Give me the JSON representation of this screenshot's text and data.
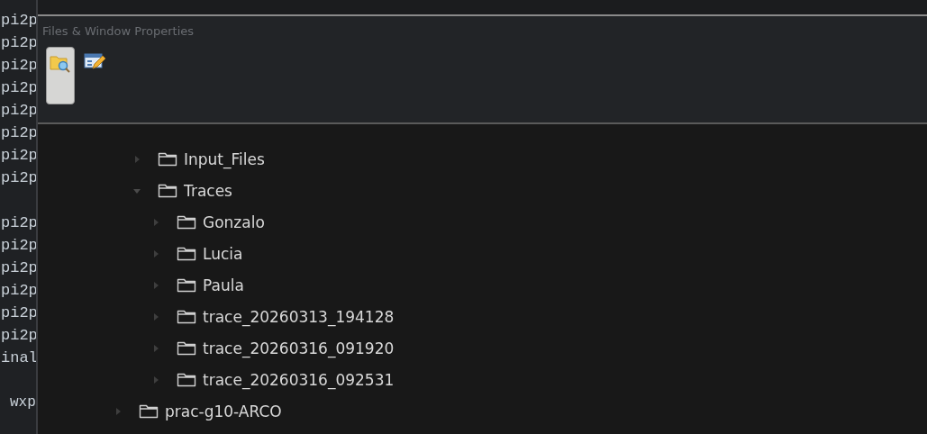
{
  "terminal": {
    "blocks": [
      {
        "indented": false,
        "lines": [
          "pi2p",
          "pi2p",
          "pi2p",
          "pi2p",
          "pi2p",
          "pi2p",
          "pi2p",
          "pi2p"
        ]
      },
      {
        "indented": false,
        "lines": [
          "pi2p",
          "pi2p",
          "pi2p",
          "pi2p",
          "pi2p",
          "pi2p",
          "inal"
        ]
      },
      {
        "indented": true,
        "lines": [
          "wxp"
        ]
      }
    ]
  },
  "panel": {
    "title": "Files & Window Properties",
    "buttons": [
      {
        "kind": "files",
        "selected": true
      },
      {
        "kind": "properties",
        "selected": false
      }
    ]
  },
  "tree": [
    {
      "children": [
        {
          "label": "Input_Files",
          "expanded": false
        },
        {
          "label": "Traces",
          "expanded": true,
          "children": [
            {
              "label": "Gonzalo",
              "expanded": false
            },
            {
              "label": "Lucia",
              "expanded": false
            },
            {
              "label": "Paula",
              "expanded": false
            },
            {
              "label": "trace_20260313_194128",
              "expanded": false
            },
            {
              "label": "trace_20260316_091920",
              "expanded": false
            },
            {
              "label": "trace_20260316_092531",
              "expanded": false
            }
          ]
        }
      ]
    },
    {
      "label": "prac-g10-ARCO",
      "expanded": false
    }
  ]
}
